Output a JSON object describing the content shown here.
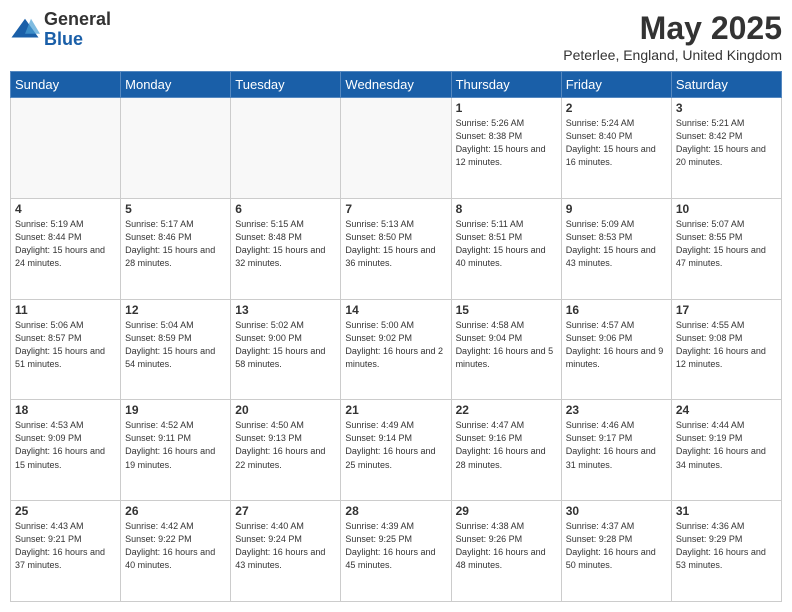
{
  "header": {
    "logo_general": "General",
    "logo_blue": "Blue",
    "month_title": "May 2025",
    "location": "Peterlee, England, United Kingdom"
  },
  "weekdays": [
    "Sunday",
    "Monday",
    "Tuesday",
    "Wednesday",
    "Thursday",
    "Friday",
    "Saturday"
  ],
  "rows": [
    [
      {
        "day": "",
        "empty": true
      },
      {
        "day": "",
        "empty": true
      },
      {
        "day": "",
        "empty": true
      },
      {
        "day": "",
        "empty": true
      },
      {
        "day": "1",
        "sunrise": "5:26 AM",
        "sunset": "8:38 PM",
        "daylight": "15 hours and 12 minutes."
      },
      {
        "day": "2",
        "sunrise": "5:24 AM",
        "sunset": "8:40 PM",
        "daylight": "15 hours and 16 minutes."
      },
      {
        "day": "3",
        "sunrise": "5:21 AM",
        "sunset": "8:42 PM",
        "daylight": "15 hours and 20 minutes."
      }
    ],
    [
      {
        "day": "4",
        "sunrise": "5:19 AM",
        "sunset": "8:44 PM",
        "daylight": "15 hours and 24 minutes."
      },
      {
        "day": "5",
        "sunrise": "5:17 AM",
        "sunset": "8:46 PM",
        "daylight": "15 hours and 28 minutes."
      },
      {
        "day": "6",
        "sunrise": "5:15 AM",
        "sunset": "8:48 PM",
        "daylight": "15 hours and 32 minutes."
      },
      {
        "day": "7",
        "sunrise": "5:13 AM",
        "sunset": "8:50 PM",
        "daylight": "15 hours and 36 minutes."
      },
      {
        "day": "8",
        "sunrise": "5:11 AM",
        "sunset": "8:51 PM",
        "daylight": "15 hours and 40 minutes."
      },
      {
        "day": "9",
        "sunrise": "5:09 AM",
        "sunset": "8:53 PM",
        "daylight": "15 hours and 43 minutes."
      },
      {
        "day": "10",
        "sunrise": "5:07 AM",
        "sunset": "8:55 PM",
        "daylight": "15 hours and 47 minutes."
      }
    ],
    [
      {
        "day": "11",
        "sunrise": "5:06 AM",
        "sunset": "8:57 PM",
        "daylight": "15 hours and 51 minutes."
      },
      {
        "day": "12",
        "sunrise": "5:04 AM",
        "sunset": "8:59 PM",
        "daylight": "15 hours and 54 minutes."
      },
      {
        "day": "13",
        "sunrise": "5:02 AM",
        "sunset": "9:00 PM",
        "daylight": "15 hours and 58 minutes."
      },
      {
        "day": "14",
        "sunrise": "5:00 AM",
        "sunset": "9:02 PM",
        "daylight": "16 hours and 2 minutes."
      },
      {
        "day": "15",
        "sunrise": "4:58 AM",
        "sunset": "9:04 PM",
        "daylight": "16 hours and 5 minutes."
      },
      {
        "day": "16",
        "sunrise": "4:57 AM",
        "sunset": "9:06 PM",
        "daylight": "16 hours and 9 minutes."
      },
      {
        "day": "17",
        "sunrise": "4:55 AM",
        "sunset": "9:08 PM",
        "daylight": "16 hours and 12 minutes."
      }
    ],
    [
      {
        "day": "18",
        "sunrise": "4:53 AM",
        "sunset": "9:09 PM",
        "daylight": "16 hours and 15 minutes."
      },
      {
        "day": "19",
        "sunrise": "4:52 AM",
        "sunset": "9:11 PM",
        "daylight": "16 hours and 19 minutes."
      },
      {
        "day": "20",
        "sunrise": "4:50 AM",
        "sunset": "9:13 PM",
        "daylight": "16 hours and 22 minutes."
      },
      {
        "day": "21",
        "sunrise": "4:49 AM",
        "sunset": "9:14 PM",
        "daylight": "16 hours and 25 minutes."
      },
      {
        "day": "22",
        "sunrise": "4:47 AM",
        "sunset": "9:16 PM",
        "daylight": "16 hours and 28 minutes."
      },
      {
        "day": "23",
        "sunrise": "4:46 AM",
        "sunset": "9:17 PM",
        "daylight": "16 hours and 31 minutes."
      },
      {
        "day": "24",
        "sunrise": "4:44 AM",
        "sunset": "9:19 PM",
        "daylight": "16 hours and 34 minutes."
      }
    ],
    [
      {
        "day": "25",
        "sunrise": "4:43 AM",
        "sunset": "9:21 PM",
        "daylight": "16 hours and 37 minutes."
      },
      {
        "day": "26",
        "sunrise": "4:42 AM",
        "sunset": "9:22 PM",
        "daylight": "16 hours and 40 minutes."
      },
      {
        "day": "27",
        "sunrise": "4:40 AM",
        "sunset": "9:24 PM",
        "daylight": "16 hours and 43 minutes."
      },
      {
        "day": "28",
        "sunrise": "4:39 AM",
        "sunset": "9:25 PM",
        "daylight": "16 hours and 45 minutes."
      },
      {
        "day": "29",
        "sunrise": "4:38 AM",
        "sunset": "9:26 PM",
        "daylight": "16 hours and 48 minutes."
      },
      {
        "day": "30",
        "sunrise": "4:37 AM",
        "sunset": "9:28 PM",
        "daylight": "16 hours and 50 minutes."
      },
      {
        "day": "31",
        "sunrise": "4:36 AM",
        "sunset": "9:29 PM",
        "daylight": "16 hours and 53 minutes."
      }
    ]
  ]
}
